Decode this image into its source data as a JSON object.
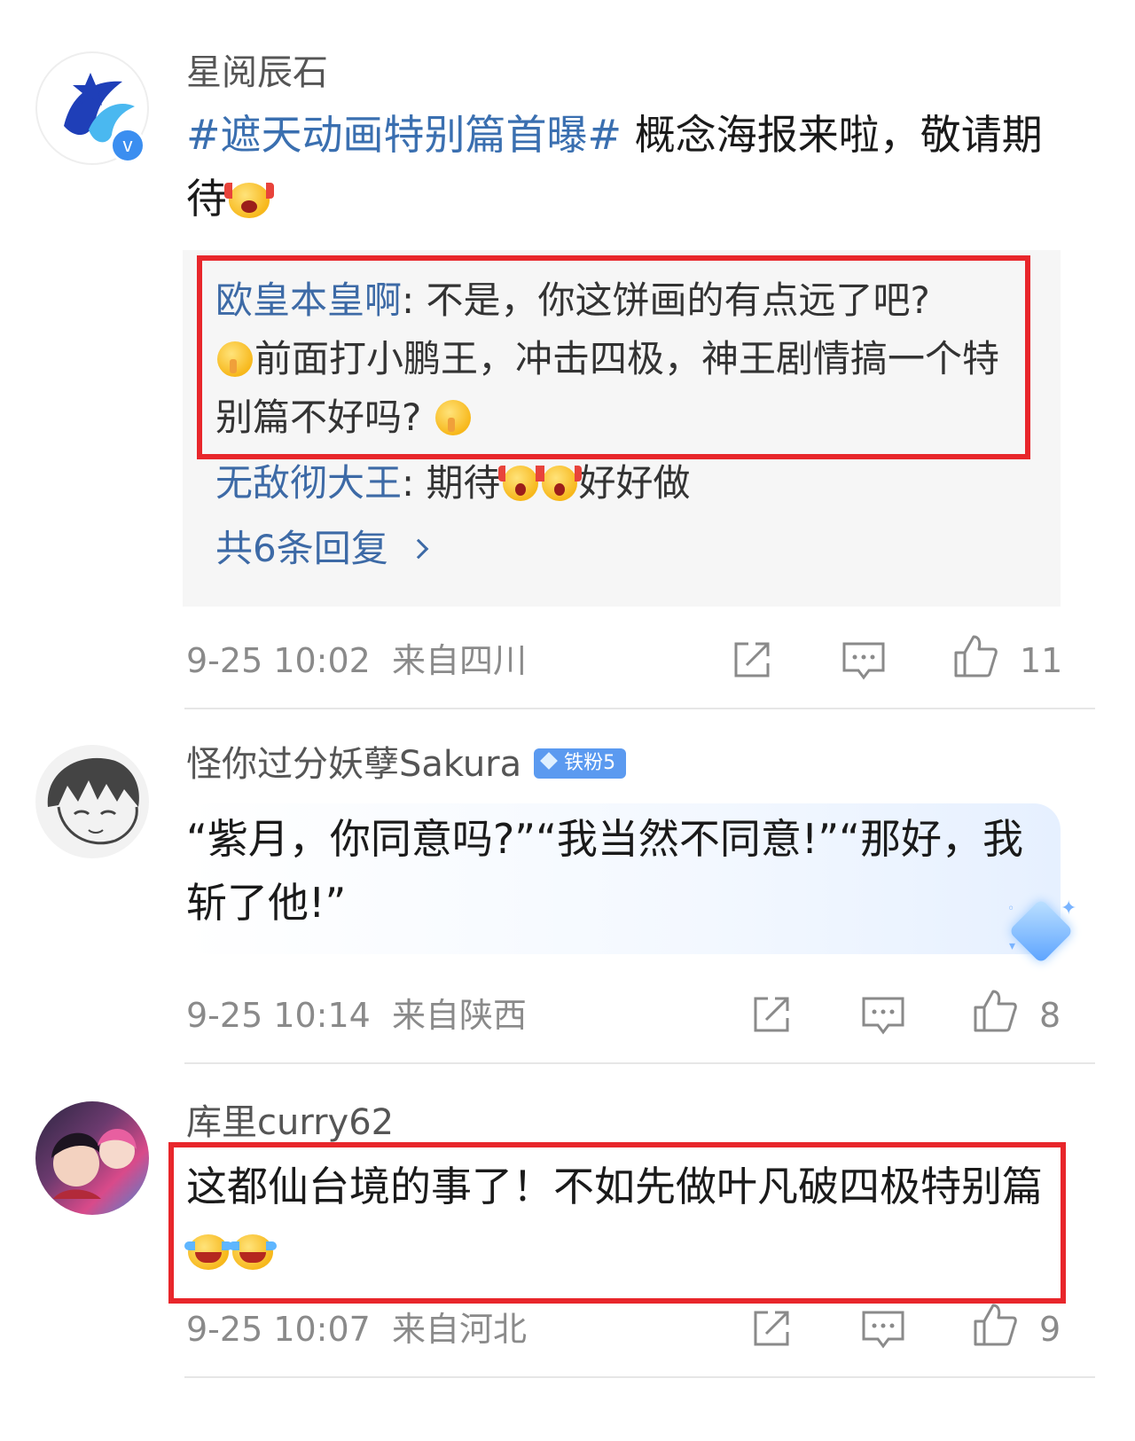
{
  "comments": [
    {
      "username": "星阅辰石",
      "hashtag": "#遮天动画特别篇首曝#",
      "text_after_hashtag": " 概念海报来啦，敬请期待",
      "emoji": "scream-emoji",
      "replies": [
        {
          "name": "欧皇本皇啊",
          "sep": ": ",
          "text_a": "不是，你这饼画的有点远了吧?",
          "text_b": "前面打小鹏王，冲击四极，神王剧情搞一个特别篇不好吗? "
        },
        {
          "name": "无敌彻大王",
          "sep": ": ",
          "text_a": "期待",
          "text_b": "好好做"
        }
      ],
      "more_replies": "共6条回复",
      "date": "9-25 10:02",
      "location": "来自四川",
      "likes": "11"
    },
    {
      "username": "怪你过分妖孽Sakura",
      "badge": "铁粉5",
      "text": "“紫月，你同意吗?”“我当然不同意!”“那好，我斩了他!”",
      "date": "9-25 10:14",
      "location": "来自陕西",
      "likes": "8"
    },
    {
      "username": "库里curry62",
      "text": "这都仙台境的事了！不如先做叶凡破四极特别篇",
      "emoji": "laughing-crying-emoji",
      "date": "9-25 10:07",
      "location": "来自河北",
      "likes": "9"
    }
  ],
  "colors": {
    "accent_link": "#3d6aa6",
    "highlight_box": "#e8262b",
    "badge": "#5b9af0",
    "meta_text": "#8a8a8a"
  },
  "icons": [
    "share-icon",
    "comment-icon",
    "like-icon",
    "verified-icon",
    "chevron-right-icon"
  ]
}
